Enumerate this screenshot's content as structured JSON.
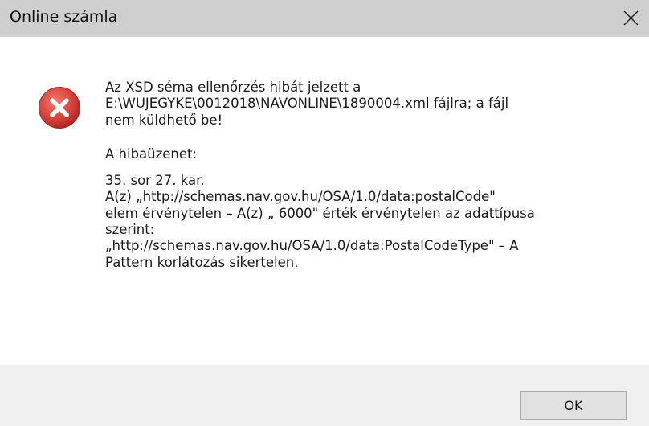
{
  "window": {
    "title": "Online számla",
    "close_icon": "close-icon"
  },
  "icon": {
    "name": "error-icon",
    "color": "#d9423a"
  },
  "message": {
    "line1": "Az XSD séma ellenőrzés hibát jelzett a",
    "line2": "E:\\WUJEGYKE\\0012018\\NAVONLINE\\1890004.xml fájlra; a fájl",
    "line3": "nem küldhető be!",
    "error_heading": "A hibaüzenet:",
    "detail1": "35. sor 27. kar.",
    "detail2": "A(z) „http://schemas.nav.gov.hu/OSA/1.0/data:postalCode\"",
    "detail3": "elem érvénytelen – A(z) „  6000\" érték érvénytelen az adattípusa",
    "detail4": "szerint:",
    "detail5": "„http://schemas.nav.gov.hu/OSA/1.0/data:PostalCodeType\" – A",
    "detail6": "Pattern korlátozás sikertelen."
  },
  "buttons": {
    "ok_label": "OK"
  }
}
